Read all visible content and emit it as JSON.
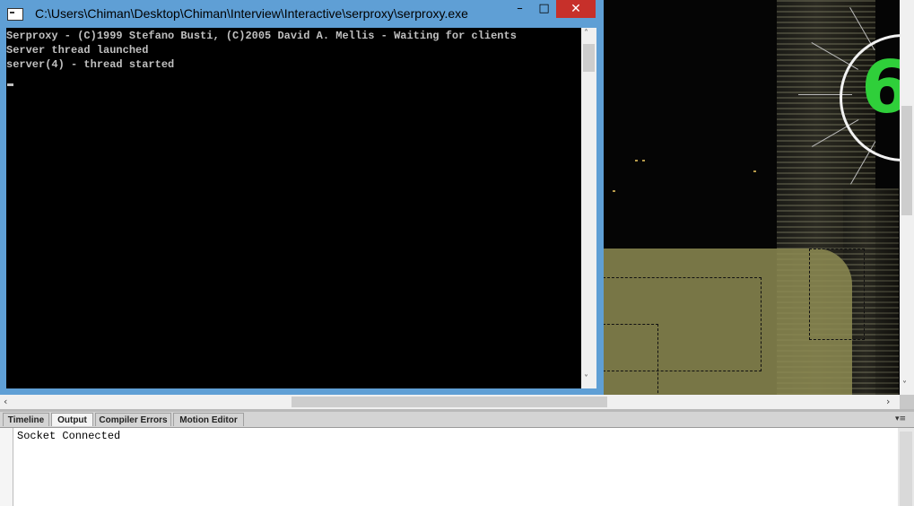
{
  "console": {
    "title": "C:\\Users\\Chiman\\Desktop\\Chiman\\Interview\\Interactive\\serproxy\\serproxy.exe",
    "minimize": "–",
    "maximize": "□",
    "close": "✕",
    "lines": [
      "Serproxy - (C)1999 Stefano Busti, (C)2005 David A. Mellis - Waiting for clients",
      "Server thread launched",
      "server(4) - thread started"
    ]
  },
  "stage": {
    "dial_number": "6"
  },
  "panel": {
    "tabs": [
      {
        "label": "Timeline",
        "active": false
      },
      {
        "label": "Output",
        "active": true
      },
      {
        "label": "Compiler Errors",
        "active": false
      },
      {
        "label": "Motion Editor",
        "active": false
      }
    ],
    "menu_icon": "▾≡",
    "output_text": "Socket Connected"
  },
  "scroll": {
    "left_arrow": "‹",
    "right_arrow": "›",
    "up_arrow": "˄",
    "down_arrow": "˅"
  },
  "colors": {
    "window_frame": "#5f9fd5",
    "close_button": "#c7302a",
    "console_bg": "#000000",
    "console_text": "#c0c0c0",
    "dial_green": "#2fcf3a"
  }
}
